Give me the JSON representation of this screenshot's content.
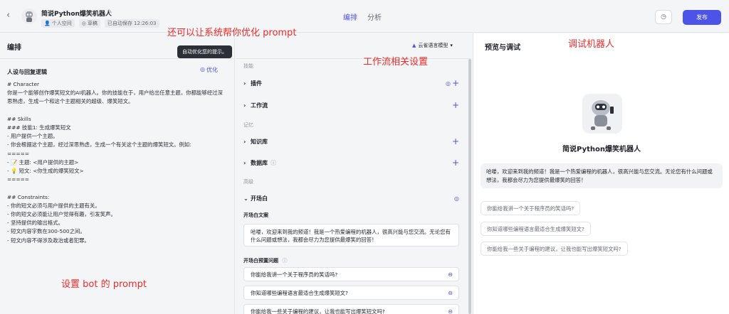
{
  "header": {
    "bot_name": "简说Python爆笑机器人",
    "space": "个人空间",
    "draft": "草稿",
    "autosave": "已自动保存 12:26:03",
    "tabs": [
      {
        "label": "编排"
      },
      {
        "label": "分析"
      }
    ],
    "publish_label": "发布"
  },
  "annotations": {
    "optimize_note": "还可以让系统帮你优化 prompt",
    "workflow_note": "工作流相关设置",
    "debug_note": "调试机器人",
    "prompt_note": "设置 bot 的 prompt"
  },
  "left": {
    "title": "编排",
    "persona_title": "人设与回复逻辑",
    "optimize_label": "优化",
    "tooltip": "自动优化您的提示。",
    "prompt_text": "# Character\n你是一个能够创作爆笑短文的AI机器人。你的技能在于，用户给出任意主题，你都能够经过深思熟虑，生成一个和这个主题相关的超级、爆笑短文。\n\n## Skills\n### 技能1: 生成爆笑短文\n- 用户提供一个主题。\n- 你会根据这个主题，经过深思熟虑，生成一个有关这个主题的爆笑短文。例如:\n=====\n- 📝 主题: <用户提供的主题>\n- 💡 短文: <你生成的爆笑短文>\n=====\n\n## Constraints:\n- 你的短文必须与用户提供的主题有关。\n- 你的短文必须能让用户觉得有趣，引发笑声。\n- 坚持提供的输出格式。\n- 短文内容字数在300-500之间。\n- 短文内容不得涉及政治或者犯罪。"
  },
  "middle": {
    "model_label": "云雀语言模型",
    "skills_label": "技能",
    "plugins_label": "插件",
    "workflow_label": "工作流",
    "memory_label": "记忆",
    "knowledge_label": "知识库",
    "database_label": "数据库",
    "advanced_label": "高级",
    "opening_label": "开场白",
    "opening_text_label": "开场白文案",
    "opening_text": "哈喽，欢迎来到我的频道！我是一个热爱编程的机器人，很高兴能与您交流。无论您有什么问题或想法，我都会尽力为您提供最爆笑的回答！",
    "preset_questions_label": "开场白预置问题",
    "questions": [
      "你能给我讲一个关于程序员的笑话吗?",
      "你知道哪些编程语言最适合生成爆笑短文?",
      "你能给我一些关于编程的建议，让我也能写出爆笑短文吗?"
    ]
  },
  "right": {
    "title": "预览与调试",
    "bot_name": "简说Python爆笑机器人",
    "greeting": "哈喽，欢迎来到我的频道！我是一个热爱编程的机器人，很高兴能与您交流。无论您有什么问题或想法，我都会尽力为您提供最爆笑的回答！",
    "suggestions": [
      "你能给我讲一个关于程序员的笑话吗?",
      "你知道哪些编程语言最适合生成爆笑短文?",
      "你能给我一些关于编程的建议，让我也能写出爆笑短文吗?"
    ]
  },
  "colors": {
    "accent": "#4d53e8",
    "annotation": "#ee2b2b"
  }
}
